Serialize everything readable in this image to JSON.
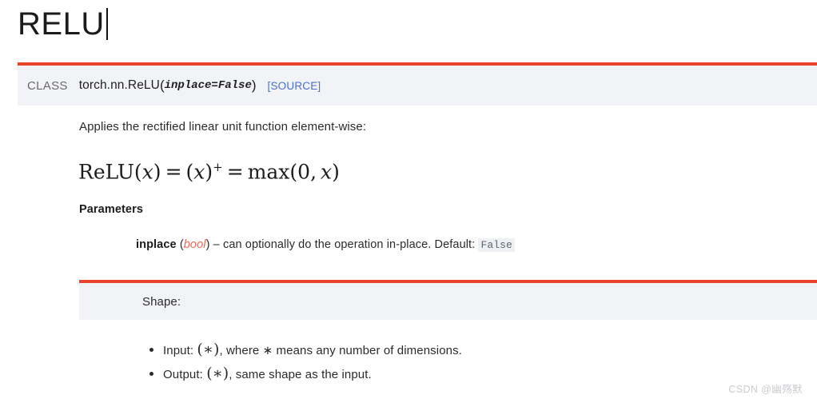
{
  "page": {
    "title": "RELU",
    "caret_visible": true
  },
  "signature": {
    "kind": "CLASS",
    "qualified_name": "torch.nn.ReLU",
    "open_paren": "(",
    "params": "inplace=False",
    "close_paren": ")",
    "source_link": "[SOURCE]"
  },
  "body": {
    "description": "Applies the rectified linear unit function element-wise:",
    "formula": {
      "plain": "ReLU(x) = (x)+ = max(0, x)",
      "lhs_name": "ReLU",
      "lhs_open": "(",
      "lhs_var": "x",
      "lhs_close": ")",
      "eq1": "=",
      "mid_open": "(",
      "mid_var": "x",
      "mid_close": ")",
      "superscript": "+",
      "eq2": "=",
      "max_name": "max",
      "max_open": "(",
      "max_zero": "0,",
      "max_var": "x",
      "max_close": ")"
    }
  },
  "parameters": {
    "heading": "Parameters",
    "items": [
      {
        "name": "inplace",
        "open_paren": "(",
        "type": "bool",
        "close_paren": ")",
        "dash": "–",
        "description": "can optionally do the operation in-place. Default:",
        "default_value": "False"
      }
    ]
  },
  "shape": {
    "label": "Shape:",
    "items": [
      {
        "prefix": "Input:",
        "symbol_open": "(",
        "symbol": "∗",
        "symbol_close": ")",
        "suffix": ", where ∗ means any number of dimensions."
      },
      {
        "prefix": "Output:",
        "symbol_open": "(",
        "symbol": "∗",
        "symbol_close": ")",
        "suffix": ", same shape as the input."
      }
    ]
  },
  "watermark": {
    "text": "CSDN @幽殇默"
  },
  "colors": {
    "accent_orange": "#e8452a",
    "panel_bg": "#f2f3f7",
    "link_blue": "#4a6fd4",
    "type_red": "#ef6a52",
    "text": "#2b2b2b"
  }
}
